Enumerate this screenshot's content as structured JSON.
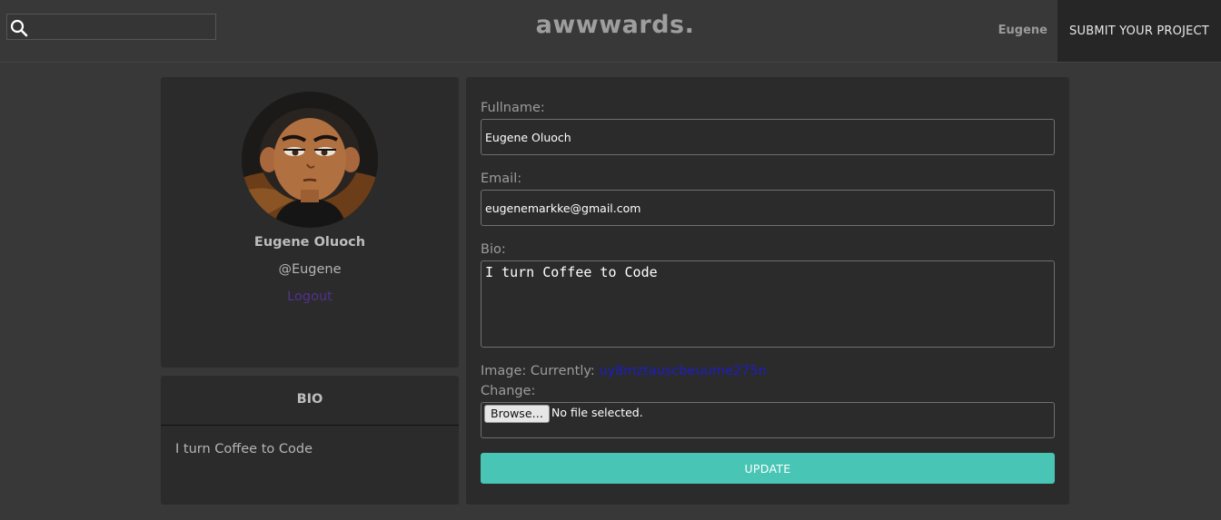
{
  "nav": {
    "search_placeholder": "",
    "brand": "awwwards.",
    "user": "Eugene",
    "submit_label": "SUBMIT YOUR PROJECT"
  },
  "profile": {
    "full_name": "Eugene Oluoch",
    "handle": "@Eugene",
    "logout_label": "Logout"
  },
  "bio_card": {
    "title": "BIO",
    "text": "I turn Coffee to Code"
  },
  "form": {
    "fullname_label": "Fullname:",
    "fullname_value": "Eugene Oluoch",
    "email_label": "Email:",
    "email_value": "eugenemarkke@gmail.com",
    "bio_label": "Bio:",
    "bio_value": "I turn Coffee to Code",
    "image_label": "Image: Currently:",
    "image_current": "uy8mztauscbeuume275n",
    "change_label": "Change:",
    "browse_label": "Browse…",
    "file_status": "No file selected.",
    "update_label": "UPDATE"
  },
  "colors": {
    "accent": "#48c5b5",
    "logout_link": "#54318e",
    "image_link": "#1d1dc9"
  }
}
